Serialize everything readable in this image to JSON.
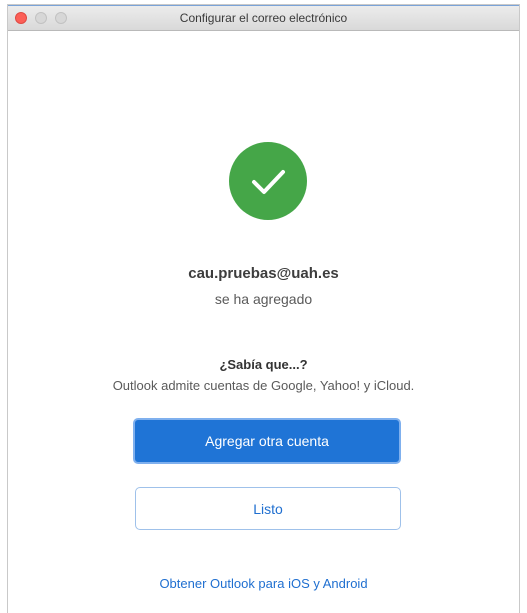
{
  "window": {
    "title": "Configurar el correo electrónico"
  },
  "status": {
    "icon": "checkmark-icon",
    "color": "#45a648",
    "email": "cau.pruebas@uah.es",
    "message": "se ha agregado"
  },
  "tip": {
    "title": "¿Sabía que...?",
    "body": "Outlook admite cuentas de Google, Yahoo! y iCloud."
  },
  "buttons": {
    "add_account": "Agregar otra cuenta",
    "done": "Listo"
  },
  "footer": {
    "mobile_link": "Obtener Outlook para iOS y Android"
  },
  "colors": {
    "primary": "#1f74d6",
    "link": "#1f6fd0",
    "close": "#fc5f57"
  }
}
